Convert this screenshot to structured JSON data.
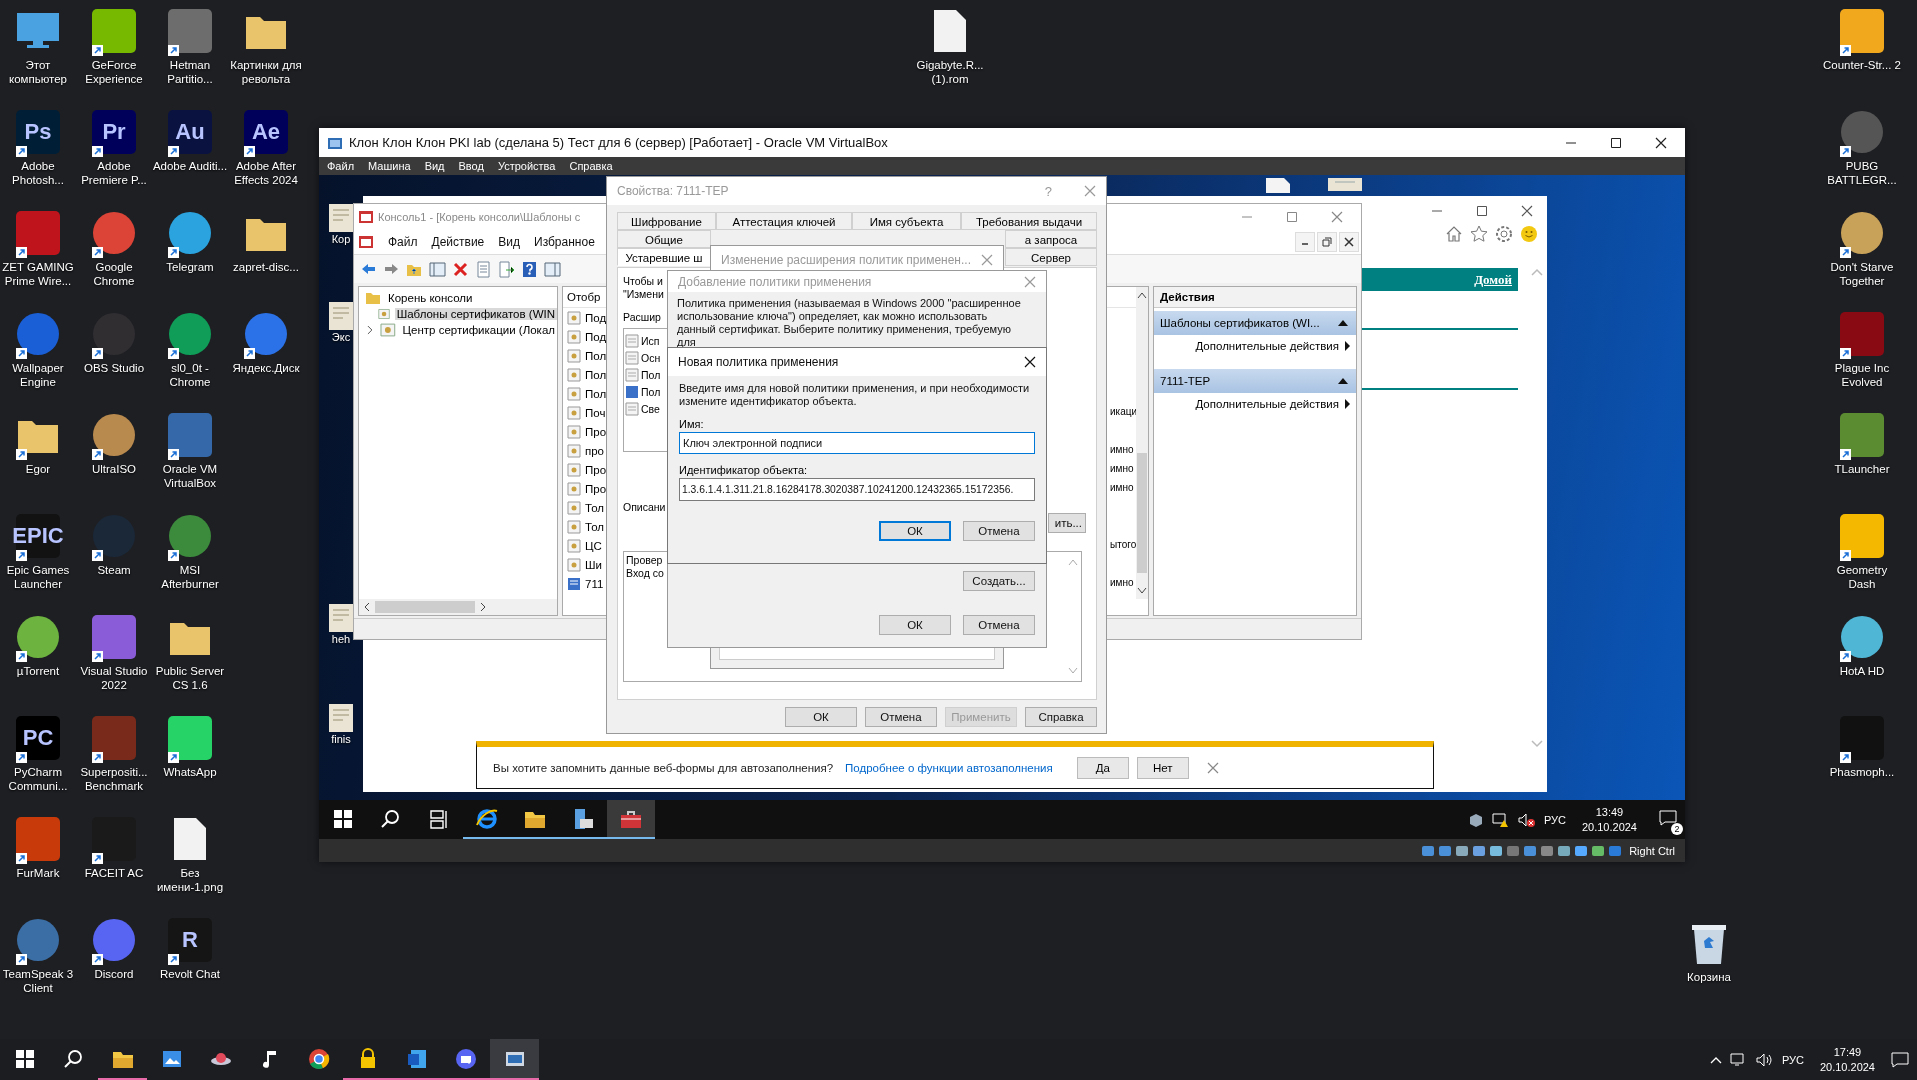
{
  "desktop": {
    "left_icons": [
      [
        {
          "label": "Этот компьютер",
          "kind": "monitor",
          "color": "#4aa3e0",
          "shortcut": false
        },
        {
          "label": "GeForce Experience",
          "kind": "tile",
          "color": "#76b900",
          "shortcut": true
        },
        {
          "label": "Hetman Partitio...",
          "kind": "tile",
          "color": "#6d6d6d",
          "shortcut": true
        },
        {
          "label": "Картинки для револьта",
          "kind": "folder",
          "color": "#e9c46a",
          "shortcut": false
        }
      ],
      [
        {
          "label": "Adobe Photosh...",
          "kind": "tile",
          "color": "#001e36",
          "glyph": "Ps",
          "shortcut": true
        },
        {
          "label": "Adobe Premiere P...",
          "kind": "tile",
          "color": "#00005b",
          "glyph": "Pr",
          "shortcut": true
        },
        {
          "label": "Adobe Auditi...",
          "kind": "tile",
          "color": "#0a1240",
          "glyph": "Au",
          "shortcut": true
        },
        {
          "label": "Adobe After Effects 2024",
          "kind": "tile",
          "color": "#00005b",
          "glyph": "Ae",
          "shortcut": true
        }
      ],
      [
        {
          "label": "ZET GAMING Prime Wire...",
          "kind": "tile",
          "color": "#c0141c",
          "shortcut": true
        },
        {
          "label": "Google Chrome",
          "kind": "circle",
          "color": "#db4437",
          "shortcut": true
        },
        {
          "label": "Telegram",
          "kind": "circle",
          "color": "#2aa3df",
          "shortcut": true
        },
        {
          "label": "zapret-disc...",
          "kind": "folder",
          "color": "#e9c46a",
          "shortcut": false
        }
      ],
      [
        {
          "label": "Wallpaper Engine",
          "kind": "circle",
          "color": "#1a5fd6",
          "shortcut": true
        },
        {
          "label": "OBS Studio",
          "kind": "circle",
          "color": "#302e31",
          "shortcut": true
        },
        {
          "label": "sl0_0t - Chrome",
          "kind": "circle",
          "color": "#0f9d58",
          "shortcut": true
        },
        {
          "label": "Яндекс.Диск",
          "kind": "circle",
          "color": "#2b72e8",
          "shortcut": true
        }
      ],
      [
        {
          "label": "Egor",
          "kind": "folder",
          "color": "#e9c46a",
          "shortcut": true
        },
        {
          "label": "UltraISO",
          "kind": "circle",
          "color": "#b98a4e",
          "shortcut": true
        },
        {
          "label": "Oracle VM VirtualBox",
          "kind": "tile",
          "color": "#3568a8",
          "shortcut": true
        }
      ],
      [
        {
          "label": "Epic Games Launcher",
          "kind": "tile",
          "color": "#121212",
          "glyph": "EPIC",
          "shortcut": true
        },
        {
          "label": "Steam",
          "kind": "circle",
          "color": "#1b2838",
          "shortcut": true
        },
        {
          "label": "MSI Afterburner",
          "kind": "circle",
          "color": "#3c8a3c",
          "shortcut": true
        }
      ],
      [
        {
          "label": "µTorrent",
          "kind": "circle",
          "color": "#6cb33f",
          "shortcut": true
        },
        {
          "label": "Visual Studio 2022",
          "kind": "tile",
          "color": "#8a5cd8",
          "shortcut": true
        },
        {
          "label": "Public Server CS 1.6",
          "kind": "folder",
          "color": "#e9c46a",
          "shortcut": false
        }
      ],
      [
        {
          "label": "PyCharm Communi...",
          "kind": "tile",
          "color": "#000000",
          "glyph": "PC",
          "shortcut": true
        },
        {
          "label": "Superpositi... Benchmark",
          "kind": "tile",
          "color": "#7a2a1a",
          "shortcut": true
        },
        {
          "label": "WhatsApp",
          "kind": "tile",
          "color": "#25d366",
          "shortcut": true
        }
      ],
      [
        {
          "label": "FurMark",
          "kind": "tile",
          "color": "#c83a0a",
          "shortcut": true
        },
        {
          "label": "FACEIT AC",
          "kind": "tile",
          "color": "#1a1a1a",
          "shortcut": true
        },
        {
          "label": "Без имени-1.png",
          "kind": "file",
          "color": "#f2f2f2",
          "shortcut": false
        }
      ],
      [
        {
          "label": "TeamSpeak 3 Client",
          "kind": "circle",
          "color": "#3a6ea5",
          "shortcut": true
        },
        {
          "label": "Discord",
          "kind": "circle",
          "color": "#5865f2",
          "shortcut": true
        },
        {
          "label": "Revolt Chat",
          "kind": "tile",
          "color": "#151515",
          "glyph": "R",
          "shortcut": true
        }
      ]
    ],
    "top_icons": [
      {
        "label": "Gigabyte.R... (1).rom",
        "kind": "file",
        "color": "#f2f2f2",
        "shortcut": false
      }
    ],
    "right_icons": [
      {
        "label": "Counter-Str... 2",
        "kind": "tile",
        "color": "#f2a81d",
        "shortcut": true
      },
      {
        "label": "PUBG BATTLEGR...",
        "kind": "circle",
        "color": "#555555",
        "shortcut": true
      },
      {
        "label": "Don't Starve Together",
        "kind": "circle",
        "color": "#c9a25a",
        "shortcut": true
      },
      {
        "label": "Plague Inc Evolved",
        "kind": "tile",
        "color": "#8a0a14",
        "shortcut": true
      },
      {
        "label": "TLauncher",
        "kind": "tile",
        "color": "#5b8c32",
        "shortcut": true
      },
      {
        "label": "Geometry Dash",
        "kind": "tile",
        "color": "#f5b800",
        "shortcut": true
      },
      {
        "label": "HotA HD",
        "kind": "circle",
        "color": "#4fb6d6",
        "shortcut": true
      },
      {
        "label": "Phasmoph...",
        "kind": "tile",
        "color": "#111111",
        "shortcut": true
      }
    ],
    "recycle_bin": {
      "label": "Корзина"
    }
  },
  "vm_window": {
    "title": "Клон Клон Клон PKI lab (сделана 5) Тест для 6 (сервер) [Работает] - Oracle VM VirtualBox",
    "menu": [
      "Файл",
      "Машина",
      "Вид",
      "Ввод",
      "Устройства",
      "Справка"
    ],
    "guest": {
      "desktop_icons": [
        {
          "label": "Кор"
        },
        {
          "label": "Экс"
        },
        {
          "label": "heh"
        },
        {
          "label": "finis"
        }
      ],
      "browser": {
        "home_link": "Домой",
        "autofill": {
          "question": "Вы хотите запомнить данные веб-формы для автозаполнения?",
          "link": "Подробнее о функции автозаполнения",
          "buttons": [
            "Да",
            "Нет"
          ]
        }
      },
      "console": {
        "title": "Консоль1 - [Корень консоли\\Шаблоны с",
        "menu": [
          "Файл",
          "Действие",
          "Вид",
          "Избранное"
        ],
        "tree": [
          {
            "label": "Корень консоли",
            "children": [
              {
                "label": "Шаблоны сертификатов (WIN",
                "selected": true
              },
              {
                "label": "Центр сертификации (Локал",
                "selected": false,
                "expanded": false
              }
            ]
          }
        ],
        "list_header": "Отобр",
        "rows": [
          {
            "name": "Под",
            "selected": false
          },
          {
            "name": "Под",
            "selected": false
          },
          {
            "name": "Пол",
            "selected": false
          },
          {
            "name": "Пол",
            "selected": false
          },
          {
            "name": "Пол",
            "selected": false
          },
          {
            "name": "Поч",
            "tail": "икаци",
            "selected": false
          },
          {
            "name": "Про",
            "selected": false
          },
          {
            "name": "про",
            "tail": "имно",
            "selected": false
          },
          {
            "name": "Про",
            "tail": "имно",
            "selected": false
          },
          {
            "name": "Про",
            "tail": "имно",
            "selected": false
          },
          {
            "name": "Тол",
            "selected": false
          },
          {
            "name": "Тол",
            "selected": false
          },
          {
            "name": "ЦС",
            "tail": "ытого",
            "selected": false
          },
          {
            "name": "Ши",
            "selected": false
          },
          {
            "name": "711",
            "tail": "имно",
            "selected": true
          }
        ],
        "actions": {
          "title": "Действия",
          "groups": [
            {
              "title": "Шаблоны сертификатов (WI...",
              "items": [
                "Дополнительные действия"
              ]
            },
            {
              "title": "7111-TEP",
              "items": [
                "Дополнительные действия"
              ]
            }
          ]
        }
      },
      "properties_dialog": {
        "title": "Свойства: 7111-TEP",
        "help": "?",
        "tab_rows": [
          [
            {
              "label": "Шифрование",
              "selected": false
            },
            {
              "label": "Аттестация ключей",
              "selected": false
            },
            {
              "label": "Имя субъекта",
              "selected": false
            },
            {
              "label": "Требования выдачи",
              "selected": false
            }
          ],
          [
            {
              "label": "Общие",
              "selected": false
            },
            {
              "label": "а запроса",
              "selected": false
            }
          ],
          [
            {
              "label": "Устаревшие ш",
              "selected": true
            },
            {
              "label": "Сервер",
              "selected": false
            }
          ]
        ],
        "intro": [
          "Чтобы и",
          "\"Измени"
        ],
        "list_label": "Расшир",
        "extensions": [
          {
            "name": "Исп",
            "selected": false
          },
          {
            "name": "Осн",
            "selected": false
          },
          {
            "name": "Пол",
            "selected": false
          },
          {
            "name": "Пол",
            "selected": true
          },
          {
            "name": "Све",
            "selected": false
          }
        ],
        "description_label": "Описани",
        "edit_button": "ить...",
        "description_lines": [
          "Провер",
          "Вход со"
        ],
        "buttons": [
          {
            "label": "ОК",
            "disabled": false
          },
          {
            "label": "Отмена",
            "disabled": false
          },
          {
            "label": "Применить",
            "disabled": true
          },
          {
            "label": "Справка",
            "disabled": false
          }
        ]
      },
      "extension_dialog": {
        "title": "Изменение расширения политик применен..."
      },
      "add_policy_dialog": {
        "title": "Добавление политики применения",
        "description": "Политика применения (называемая в  Windows 2000 \"расширенное использование ключа\") определяет, как можно использовать данный сертификат. Выберите политику применения, требуемую для",
        "create_button": "Создать...",
        "buttons": [
          "ОК",
          "Отмена"
        ]
      },
      "new_policy_dialog": {
        "title": "Новая политика применения",
        "description": "Введите имя для новой политики применения, и при необходимости измените идентификатор объекта.",
        "name_label": "Имя:",
        "name_value": "Ключ электронной подписи",
        "oid_label": "Идентификатор объекта:",
        "oid_value": "1.3.6.1.4.1.311.21.8.16284178.3020387.10241200.12432365.15172356.",
        "buttons": [
          "ОК",
          "Отмена"
        ]
      },
      "taskbar": {
        "apps": [
          {
            "kind": "start"
          },
          {
            "kind": "search"
          },
          {
            "kind": "taskview"
          },
          {
            "kind": "ie",
            "running": true,
            "active": false
          },
          {
            "kind": "explorer",
            "running": true,
            "active": false
          },
          {
            "kind": "server",
            "running": true,
            "active": false
          },
          {
            "kind": "toolbox",
            "running": true,
            "active": true
          }
        ],
        "language": "РУС",
        "time": "13:49",
        "date": "20.10.2024",
        "notifications": "2"
      }
    },
    "status_bar": {
      "host_key": "Right Ctrl"
    }
  },
  "host_taskbar": {
    "apps": [
      {
        "kind": "start"
      },
      {
        "kind": "search"
      },
      {
        "kind": "explorer",
        "running": true,
        "active": false
      },
      {
        "kind": "photos",
        "running": false,
        "active": false
      },
      {
        "kind": "saucer",
        "running": false,
        "active": false
      },
      {
        "kind": "music",
        "running": false,
        "active": false
      },
      {
        "kind": "chrome",
        "running": false,
        "active": false
      },
      {
        "kind": "lock",
        "running": true,
        "active": false
      },
      {
        "kind": "word",
        "running": true,
        "active": false
      },
      {
        "kind": "discord",
        "running": true,
        "active": false
      },
      {
        "kind": "virtualbox",
        "running": true,
        "active": true
      }
    ],
    "language": "РУС",
    "time": "17:49",
    "date": "20.10.2024"
  }
}
